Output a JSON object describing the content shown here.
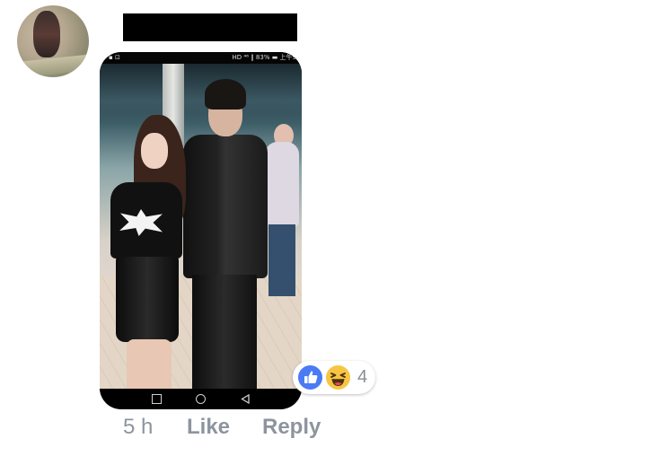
{
  "comment": {
    "photo": {
      "status_bar": {
        "left": "▪ ⊡",
        "right": "HD ⁴⁶ ‖ 83% ▬ 上午9"
      }
    },
    "reactions": {
      "types": [
        "like-icon",
        "haha-icon"
      ],
      "count": "4",
      "like_color": "#4a7bf4",
      "haha_color": "#f7c544"
    },
    "actions": {
      "time": "5 h",
      "like_label": "Like",
      "reply_label": "Reply"
    }
  }
}
